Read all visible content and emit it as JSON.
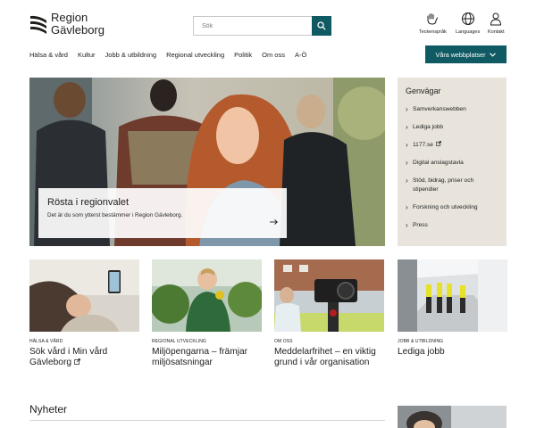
{
  "brand": {
    "name_line1": "Region",
    "name_line2": "Gävleborg"
  },
  "search": {
    "placeholder": "Sök"
  },
  "utility": [
    {
      "label": "Teckenspråk",
      "icon": "sign-language-icon"
    },
    {
      "label": "Languages",
      "icon": "globe-icon"
    },
    {
      "label": "Kontakt",
      "icon": "contact-person-icon"
    }
  ],
  "nav": [
    "Hälsa & vård",
    "Kultur",
    "Jobb & utbildning",
    "Regional utveckling",
    "Politik",
    "Om oss",
    "A-Ö"
  ],
  "sites_button": "Våra webbplatser",
  "hero": {
    "title": "Rösta i regionvalet",
    "subtitle": "Det är du som ytterst bestämmer i Region Gävleborg."
  },
  "genvagar": {
    "title": "Genvägar",
    "items": [
      {
        "label": "Samverkanswebben"
      },
      {
        "label": "Lediga jobb"
      },
      {
        "label": "1177.se",
        "external": true
      },
      {
        "label": "Digital anslagstavla"
      },
      {
        "label": "Stöd, bidrag, priser och stipendier"
      },
      {
        "label": "Forskning och utveckling"
      },
      {
        "label": "Press"
      }
    ]
  },
  "cards": [
    {
      "category": "Hälsa & vård",
      "title": "Sök vård i Min vård Gävleborg",
      "external": true
    },
    {
      "category": "Regional utveckling",
      "title": "Miljöpengarna – främjar miljösatsningar"
    },
    {
      "category": "Om oss",
      "title": "Meddelarfrihet – en viktig grund i vår organisation"
    },
    {
      "category": "Jobb & utbildning",
      "title": "Lediga jobb"
    }
  ],
  "news": {
    "title": "Nyheter"
  },
  "colors": {
    "accent": "#0f5a63",
    "panel": "#e8e4dc",
    "text": "#1d1d1b"
  }
}
